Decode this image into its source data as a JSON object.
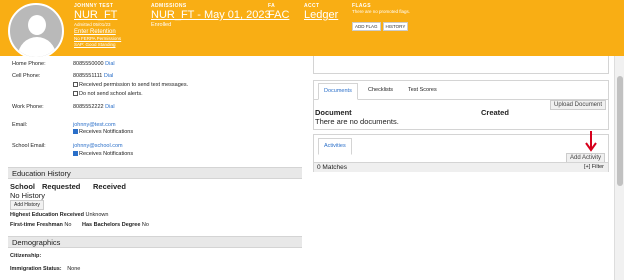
{
  "header": {
    "student_label": "JOHNNY TEST",
    "student_id": "NUR_FT",
    "admitted": "Admitted 05/01/23",
    "enter_retention": "Enter Retention",
    "no_ferpa": "No FERPA Permissions",
    "sap": "SAP: Good Standing",
    "admissions_label": "ADMISSIONS",
    "admissions_link": "NUR_FT - May 01, 2023",
    "enrolled": "Enrolled",
    "fa_label": "FA",
    "fa_link": "FAC",
    "acct_label": "ACCT",
    "acct_link": "Ledger",
    "flags_label": "FLAGS",
    "flags_note": "There are no promoted flags.",
    "add_flag": "ADD FLAG",
    "history": "HISTORY"
  },
  "contact": {
    "home_phone_label": "Home Phone:",
    "home_phone": "8085550000",
    "dial1": "Dial",
    "cell_phone_label": "Cell Phone:",
    "cell_phone": "8085551111",
    "dial2": "Dial",
    "received_text": "Received permission to send text messages.",
    "no_school_alerts": "Do not send school alerts.",
    "work_phone_label": "Work Phone:",
    "work_phone": "8085552222",
    "dial3": "Dial",
    "email_label": "Email:",
    "email": "johnny@test.com",
    "receives_notifications": "Receives Notifications",
    "school_email_label": "School Email:",
    "school_email": "johnny@school.com",
    "receives_notifications2": "Receives Notifications"
  },
  "education": {
    "title": "Education History",
    "col_school": "School",
    "col_requested": "Requested",
    "col_received": "Received",
    "empty": "No History",
    "add_history": "Add History",
    "highest_label": "Highest Education Received",
    "highest_value": "Unknown",
    "first_time_label": "First-time Freshman",
    "first_time_value": "No",
    "bachelors_label": "Has Bachelors Degree",
    "bachelors_value": "No"
  },
  "demographics": {
    "title": "Demographics",
    "citizenship_label": "Citizenship:",
    "immigration_label": "Immigration Status:",
    "immigration_value": "None"
  },
  "right": {
    "tabs": [
      "Documents",
      "Checklists",
      "Test Scores"
    ],
    "upload": "Upload Document",
    "col_document": "Document",
    "col_created": "Created",
    "no_docs": "There are no documents.",
    "activities_tab": "Activities",
    "add_activity": "Add Activity",
    "matches": "0 Matches",
    "filter": "[+] Filter"
  },
  "colors": {
    "header_bg": "#f9ae14",
    "link_blue": "#2a6fc9",
    "arrow_red": "#d6001c"
  }
}
